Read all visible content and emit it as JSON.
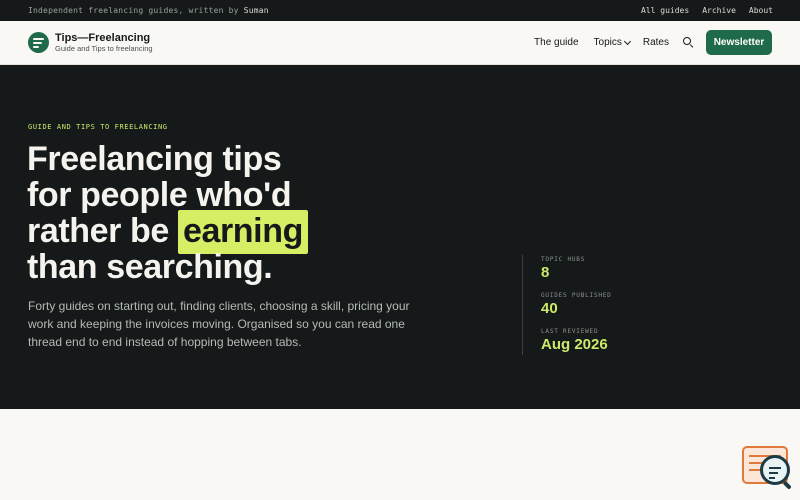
{
  "topbar": {
    "tagline_prefix": "Independent freelancing guides, written by",
    "author": "Suman",
    "links": [
      "All guides",
      "Archive",
      "About"
    ]
  },
  "header": {
    "brand_name": "Tips—Freelancing",
    "brand_sub": "Guide and Tips to freelancing",
    "nav": {
      "guide": "The guide",
      "topics": "Topics",
      "rates": "Rates"
    },
    "newsletter": "Newsletter"
  },
  "hero": {
    "eyebrow": "GUIDE AND TIPS TO FREELANCING",
    "headline_a": "Freelancing tips",
    "headline_b": "for people who'd",
    "headline_c": "rather be",
    "headline_highlight": "earning",
    "headline_d": "than searching.",
    "lede": "Forty guides on starting out, finding clients, choosing a skill, pricing your work and keeping the invoices moving. Organised so you can read one thread end to end instead of hopping between tabs.",
    "stats": [
      {
        "label": "TOPIC HUBS",
        "value": "8"
      },
      {
        "label": "GUIDES PUBLISHED",
        "value": "40"
      },
      {
        "label": "LAST REVIEWED",
        "value": "Aug 2026"
      }
    ]
  },
  "colors": {
    "dark": "#15191a",
    "brand_green": "#1f6a4a",
    "lime": "#cde96a",
    "highlight": "#d4ef63",
    "widget_orange": "#e07a3a"
  }
}
